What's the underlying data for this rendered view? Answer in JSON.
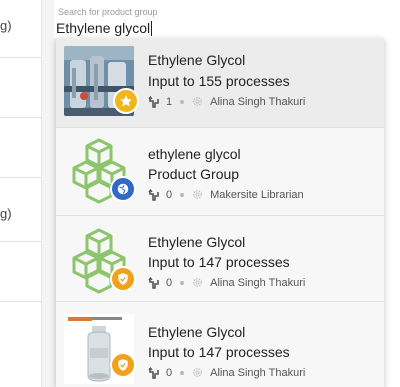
{
  "background": {
    "left_rows": [
      {
        "unit": "g)"
      },
      {
        "unit": ""
      },
      {
        "unit": ""
      },
      {
        "unit": "g)"
      },
      {
        "unit": ""
      }
    ]
  },
  "search": {
    "label": "Search for product group",
    "value": "Ethylene glycol"
  },
  "results": [
    {
      "title": "Ethylene Glycol",
      "subtitle": "Input to 155 processes",
      "fork_count": "1",
      "author": "Alina Singh Thakuri",
      "thumbnail": "factory-photo",
      "badge_icon": "star-icon",
      "badge_color": "#f2b51c"
    },
    {
      "title": "ethylene glycol",
      "subtitle": "Product Group",
      "fork_count": "0",
      "author": "Makersite Librarian",
      "thumbnail": "cubes-icon",
      "badge_icon": "globe-icon",
      "badge_color": "#2f69c9"
    },
    {
      "title": "Ethylene Glycol",
      "subtitle": "Input to 147 processes",
      "fork_count": "0",
      "author": "Alina Singh Thakuri",
      "thumbnail": "cubes-icon",
      "badge_icon": "shield-icon",
      "badge_color": "#f2a11c"
    },
    {
      "title": "Ethylene Glycol",
      "subtitle": "Input to 147 processes",
      "fork_count": "0",
      "author": "Alina Singh Thakuri",
      "thumbnail": "bottle-photo",
      "badge_icon": "shield-icon",
      "badge_color": "#f2a11c"
    }
  ],
  "colors": {
    "cube_green": "#8cc56b",
    "star_badge": "#f2b51c",
    "globe_badge": "#2f69c9",
    "shield_badge": "#f2a11c"
  }
}
